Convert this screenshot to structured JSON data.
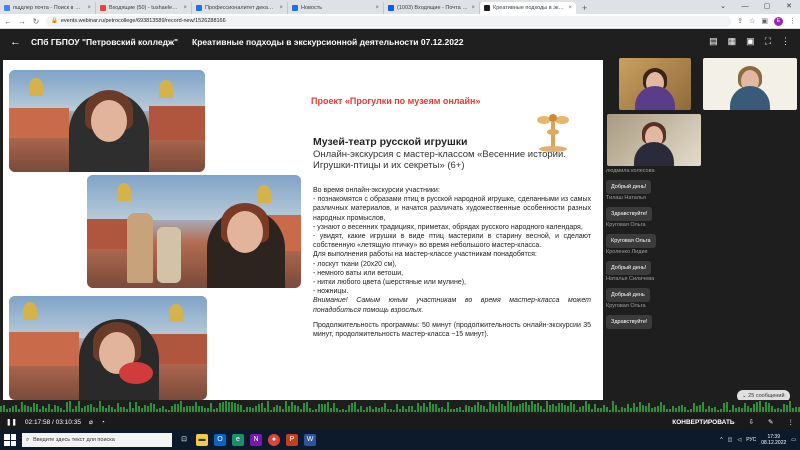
{
  "browser": {
    "tabs": [
      {
        "label": "пщдлер почта - Поиск в Google",
        "color": "#4285f4"
      },
      {
        "label": "Входящие (50) - tushaelena6110@...",
        "color": "#ea4335"
      },
      {
        "label": "Профессионалитет декабрь 2022",
        "color": "#1a73e8"
      },
      {
        "label": "Новость",
        "color": "#1a73e8"
      },
      {
        "label": "(1003) Входящие - Почта Mail.ru",
        "color": "#005ff9"
      },
      {
        "label": "Креативные подходы в экску...",
        "color": "#1e1e1e"
      }
    ],
    "url": "events.webinar.ru/petrocollege/693813589/record-new/1526288166",
    "profile_initial": "E"
  },
  "header": {
    "org": "СПб ГБПОУ \"Петровский колледж\"",
    "title": "Креативные подходы в экскурсионной деятельности 07.12.2022"
  },
  "slide": {
    "project": "Проект «Прогулки по музеям онлайн»",
    "museum": "Музей-театр русской игрушки",
    "subtitle": "Онлайн-экскурсия с мастер-классом «Весенние истории. Игрушки-птицы и их секреты» (6+)",
    "intro": "Во время онлайн-экскурсии участники:",
    "bullet1": "-   познакомятся с образами птиц в русской народной игрушке, сделанными из самых различных материалов, и начатся различать художественные особенности разных народных промыслов,",
    "bullet2": "- узнают о весенних традициях, приметах, обрядах русского народного календаря,",
    "bullet3": "- увидят, какие игрушки в виде птиц мастерили в старину весной, и сделают собственную «летящую птичку» во время небольшого мастер-класса.",
    "materials_intro": "Для выполнения работы на мастер-классе участникам понадобятся:",
    "m1": "- лоскут ткани (20х20 см),",
    "m2": "- немного ваты или ветоши,",
    "m3": "- нитки любого цвета (шерстяные или мулине),",
    "m4": "- ножницы.",
    "note": "Внимание! Самым юным участникам во время мастер-класса может понадобиться помощь взрослых.",
    "duration": "Продолжительность программы: 50 минут (продолжительность онлайн-экскурсии 35 минут, продолжительность мастер-класса ~15 минут)."
  },
  "chat": {
    "messages": [
      {
        "name": "людмила колесова",
        "text": "Добрый день!"
      },
      {
        "name": "Тилаш Наталья",
        "text": "Здравствуйте!"
      },
      {
        "name": "Круговая Ольга",
        "text": "Круговая Ольга"
      },
      {
        "name": "Кроленко Лидия",
        "text": "Добрый день!"
      },
      {
        "name": "Наталья Силичева",
        "text": "Добрый день"
      },
      {
        "name": "Круговая Ольга",
        "text": "Здравствуйте!"
      }
    ],
    "count": "25 сообщений"
  },
  "player": {
    "time": "02:17:58 / 03:10:35",
    "convert": "КОНВЕРТИРОВАТЬ"
  },
  "taskbar": {
    "search_placeholder": "Введите здесь текст для поиска",
    "lang": "РУС",
    "time": "17:39",
    "date": "08.12.2022"
  },
  "colors": {
    "accent_red": "#e53935",
    "wave_green": "#2f8f3a"
  }
}
